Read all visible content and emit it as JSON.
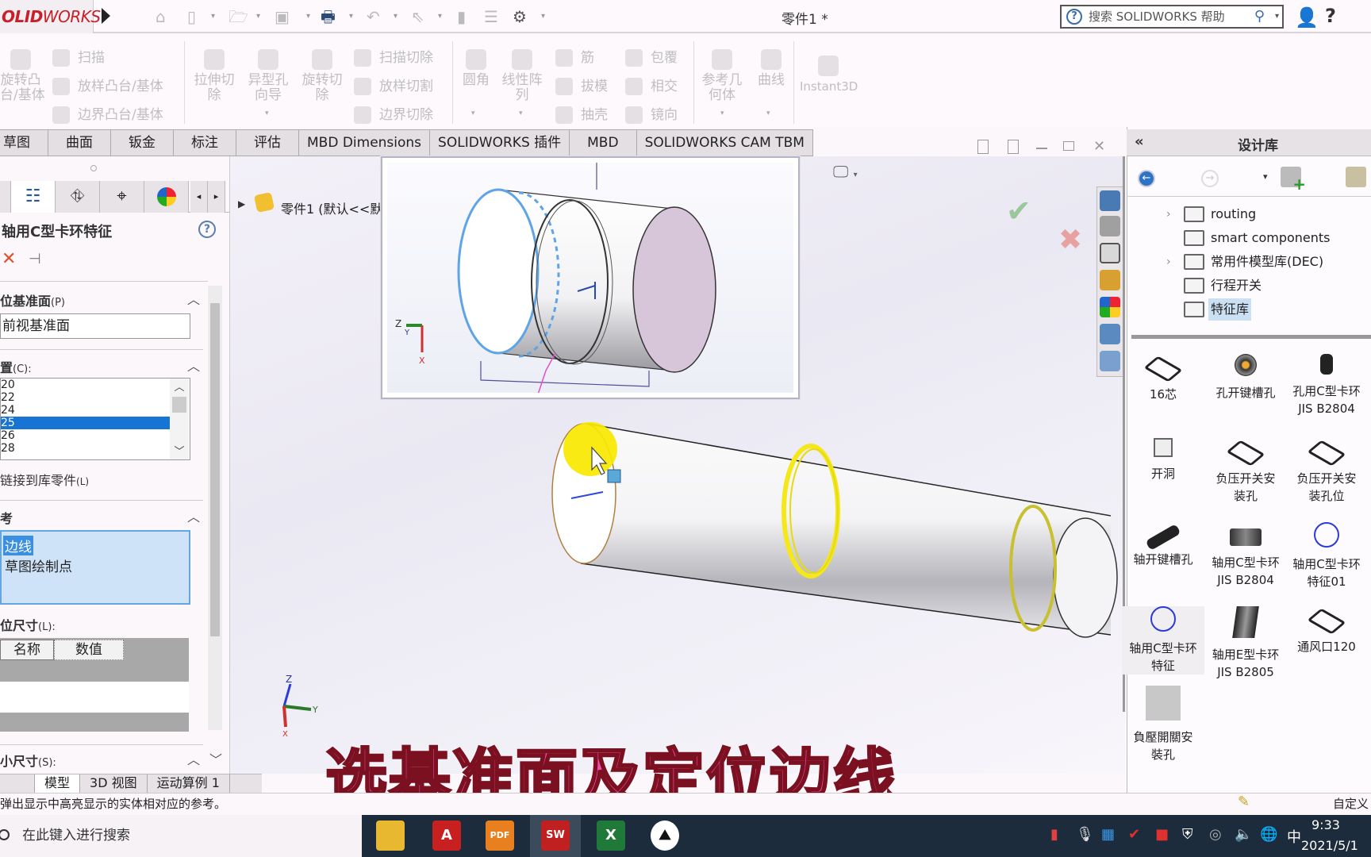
{
  "app": {
    "logo": {
      "bold": "OLID",
      "rest": "WORKS"
    },
    "document_title": "零件1 *",
    "help_search_placeholder": "搜索 SOLIDWORKS 帮助"
  },
  "ribbon": {
    "groups": [
      {
        "items": [
          {
            "label": "旋转凸\n台/基体",
            "size": "large"
          },
          {
            "label": "扫描"
          },
          {
            "label": "放样凸台/基体"
          },
          {
            "label": "边界凸台/基体"
          }
        ]
      },
      {
        "items": [
          {
            "label": "拉伸切\n除",
            "size": "large"
          },
          {
            "label": "异型孔\n向导",
            "size": "large"
          },
          {
            "label": "旋转切\n除",
            "size": "large"
          },
          {
            "label": "扫描切除"
          },
          {
            "label": "放样切割"
          },
          {
            "label": "边界切除"
          }
        ]
      },
      {
        "items": [
          {
            "label": "圆角",
            "size": "large"
          },
          {
            "label": "线性阵\n列",
            "size": "large"
          },
          {
            "label": "筋"
          },
          {
            "label": "拔模"
          },
          {
            "label": "抽壳"
          },
          {
            "label": "包覆"
          },
          {
            "label": "相交"
          },
          {
            "label": "镜向"
          }
        ]
      },
      {
        "items": [
          {
            "label": "参考几\n何体",
            "size": "large"
          },
          {
            "label": "曲线",
            "size": "large"
          }
        ]
      },
      {
        "items": [
          {
            "label": "Instant3D",
            "size": "large"
          }
        ]
      }
    ]
  },
  "command_tabs": [
    "草图",
    "曲面",
    "钣金",
    "标注",
    "评估",
    "MBD Dimensions",
    "SOLIDWORKS 插件",
    "MBD",
    "SOLIDWORKS CAM TBM"
  ],
  "property_manager": {
    "title": "轴用C型卡环特征",
    "sections": {
      "placement_plane": {
        "label": "位基准面",
        "shortcut": "(P)",
        "value": "前视基准面"
      },
      "size": {
        "label": "置",
        "shortcut": "(C):",
        "options": [
          "20",
          "22",
          "24",
          "25",
          "26",
          "28"
        ],
        "selected": "25"
      },
      "link_to_library": "链接到库零件",
      "link_shortcut": "(L)",
      "references": {
        "label": "考",
        "items": [
          "边线",
          "草图绘制点"
        ],
        "selected": "边线"
      },
      "location_dims": {
        "label": "位尺寸",
        "shortcut": "(L):",
        "columns": [
          "名称",
          "数值"
        ]
      },
      "size_dims": {
        "label": "小尺寸",
        "shortcut": "(S):"
      }
    }
  },
  "feature_tree": {
    "root_label": "零件1  (默认<<默"
  },
  "bottom_tabs": [
    {
      "label": "模型",
      "active": true
    },
    {
      "label": "3D 视图",
      "active": false
    },
    {
      "label": "运动算例 1",
      "active": false
    }
  ],
  "status_bar": {
    "message": "弹出显示中高亮显示的实体相对应的参考。",
    "right": "自定义"
  },
  "design_library": {
    "title": "设计库",
    "folders": [
      {
        "label": "routing",
        "expandable": true,
        "selected": false
      },
      {
        "label": "smart components",
        "expandable": false,
        "selected": false
      },
      {
        "label": "常用件模型库(DEC)",
        "expandable": true,
        "selected": false
      },
      {
        "label": "行程开关",
        "expandable": false,
        "selected": false
      },
      {
        "label": "特征库",
        "expandable": false,
        "selected": true
      }
    ],
    "items": [
      {
        "label": "16芯",
        "icon": "plate-icon"
      },
      {
        "label": "孔开键槽孔",
        "icon": "bearing-icon"
      },
      {
        "label": "孔用C型卡环\nJIS B2804",
        "icon": "cylinder-icon"
      },
      {
        "label": "开洞",
        "icon": "square-hole-icon"
      },
      {
        "label": "负压开关安\n装孔",
        "icon": "plate-icon"
      },
      {
        "label": "负压开关安\n装孔位",
        "icon": "plate-icon"
      },
      {
        "label": "轴开键槽孔",
        "icon": "shaft-icon"
      },
      {
        "label": "轴用C型卡环\nJIS B2804",
        "icon": "block-icon"
      },
      {
        "label": "轴用C型卡环\n特征01",
        "icon": "circle-sketch-icon"
      },
      {
        "label": "轴用C型卡环\n特征",
        "icon": "circle-sketch-icon"
      },
      {
        "label": "轴用E型卡环\nJIS B2805",
        "icon": "shaft-block-icon"
      },
      {
        "label": "通风口120",
        "icon": "plate-icon"
      },
      {
        "label": "負壓開關安\n裝孔",
        "icon": "gray-part-icon"
      }
    ]
  },
  "caption": "选基准面及定位边线",
  "taskbar": {
    "search_placeholder": "在此键入进行搜索",
    "apps": [
      {
        "name": "file-explorer",
        "label": ""
      },
      {
        "name": "autocad",
        "label": "A"
      },
      {
        "name": "pdf",
        "label": "PDF"
      },
      {
        "name": "solidworks-2020",
        "label": "SW"
      },
      {
        "name": "excel",
        "label": "X"
      },
      {
        "name": "app-mountain",
        "label": ""
      }
    ],
    "ime": "中",
    "time": "9:33",
    "date": "2021/5/1"
  }
}
